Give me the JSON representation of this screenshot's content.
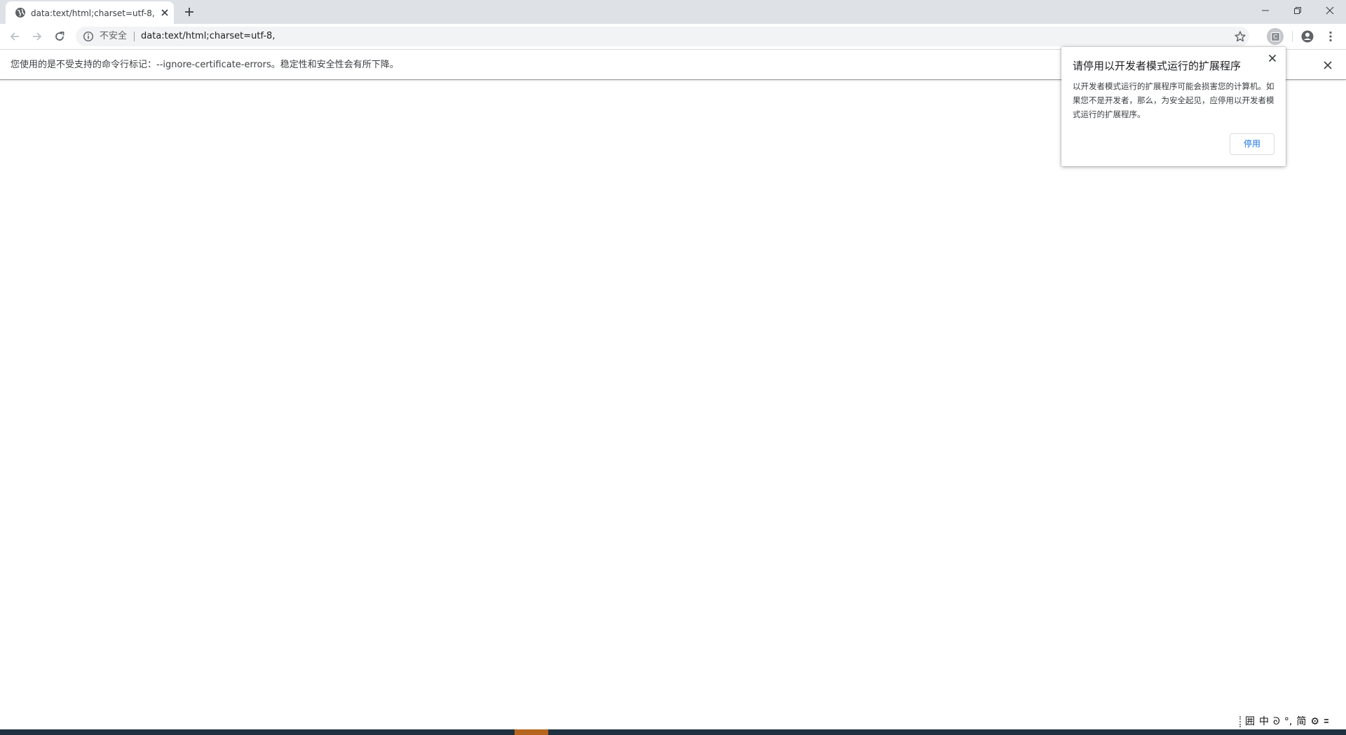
{
  "tab": {
    "title": "data:text/html;charset=utf-8,",
    "favicon": "globe-icon"
  },
  "toolbar": {
    "security_label": "不安全",
    "url": "data:text/html;charset=utf-8,",
    "extension_letter": "C"
  },
  "infobar": {
    "message": "您使用的是不受支持的命令行标记：--ignore-certificate-errors。稳定性和安全性会有所下降。"
  },
  "bubble": {
    "title": "请停用以开发者模式运行的扩展程序",
    "body": "以开发者模式运行的扩展程序可能会损害您的计算机。如果您不是开发者，那么，为安全起见，应停用以开发者模式运行的扩展程序。",
    "button_label": "停用",
    "accent_color": "#1a73e8"
  },
  "ime": {
    "items": [
      "囲",
      "中",
      "ᘐ",
      "°,",
      "简",
      "⚙"
    ]
  },
  "colors": {
    "tabstrip": "#dee1e6",
    "omnibox": "#f1f3f4",
    "taskbar": "#1f3140",
    "taskbar_active": "#b5651d"
  }
}
